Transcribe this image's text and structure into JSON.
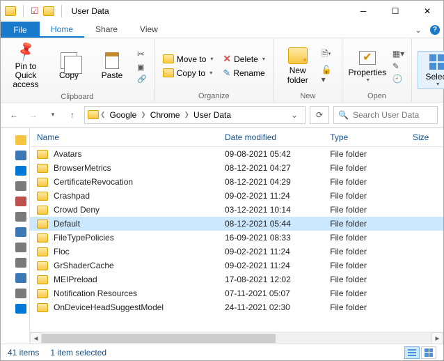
{
  "window": {
    "title": "User Data"
  },
  "tabs": {
    "file": "File",
    "home": "Home",
    "share": "Share",
    "view": "View"
  },
  "ribbon": {
    "pin": "Pin to Quick\naccess",
    "copy": "Copy",
    "paste": "Paste",
    "moveto": "Move to",
    "copyto": "Copy to",
    "delete": "Delete",
    "rename": "Rename",
    "newfolder": "New\nfolder",
    "properties": "Properties",
    "select": "Select",
    "group_clipboard": "Clipboard",
    "group_organize": "Organize",
    "group_new": "New",
    "group_open": "Open",
    "group_select": ""
  },
  "nav": {
    "crumbs": [
      "Google",
      "Chrome",
      "User Data"
    ],
    "search_placeholder": "Search User Data"
  },
  "columns": {
    "name": "Name",
    "date": "Date modified",
    "type": "Type",
    "size": "Size"
  },
  "files": [
    {
      "name": "Avatars",
      "date": "09-08-2021 05:42",
      "type": "File folder"
    },
    {
      "name": "BrowserMetrics",
      "date": "08-12-2021 04:27",
      "type": "File folder"
    },
    {
      "name": "CertificateRevocation",
      "date": "08-12-2021 04:29",
      "type": "File folder"
    },
    {
      "name": "Crashpad",
      "date": "09-02-2021 11:24",
      "type": "File folder"
    },
    {
      "name": "Crowd Deny",
      "date": "03-12-2021 10:14",
      "type": "File folder"
    },
    {
      "name": "Default",
      "date": "08-12-2021 05:44",
      "type": "File folder",
      "selected": true
    },
    {
      "name": "FileTypePolicies",
      "date": "16-09-2021 08:33",
      "type": "File folder"
    },
    {
      "name": "Floc",
      "date": "09-02-2021 11:24",
      "type": "File folder"
    },
    {
      "name": "GrShaderCache",
      "date": "09-02-2021 11:24",
      "type": "File folder"
    },
    {
      "name": "MEIPreload",
      "date": "17-08-2021 12:02",
      "type": "File folder"
    },
    {
      "name": "Notification Resources",
      "date": "07-11-2021 05:07",
      "type": "File folder"
    },
    {
      "name": "OnDeviceHeadSuggestModel",
      "date": "24-11-2021 02:30",
      "type": "File folder"
    }
  ],
  "status": {
    "count": "41 items",
    "selection": "1 item selected"
  },
  "sidebar_colors": [
    "#f5c542",
    "#3b78b5",
    "#0078d7",
    "#7a7a7a",
    "#c0504d",
    "#7a7a7a",
    "#3b78b5",
    "#7a7a7a",
    "#7a7a7a",
    "#3b78b5",
    "#7a7a7a",
    "#0078d7"
  ]
}
